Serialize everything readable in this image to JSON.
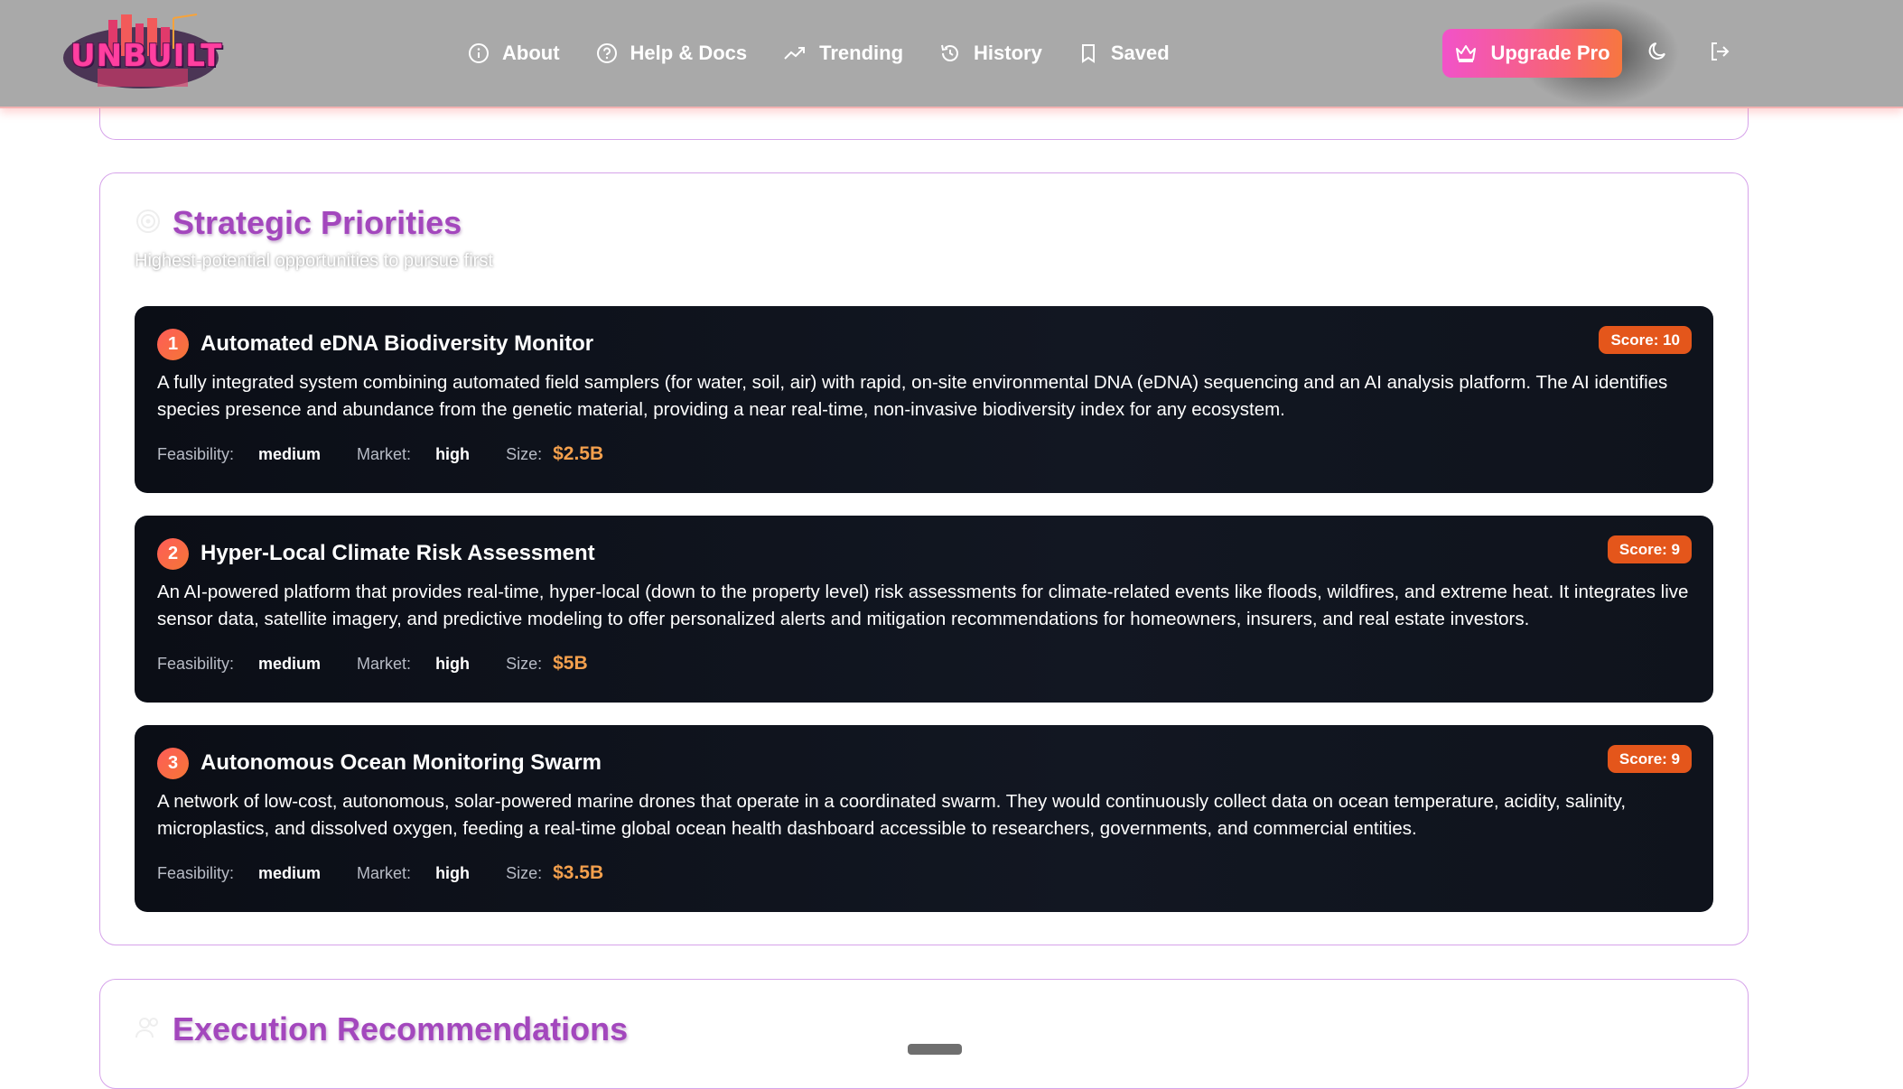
{
  "app": {
    "logo_text": "UNBUILT"
  },
  "nav": {
    "links": [
      {
        "label": "About",
        "icon": "info-circle-icon"
      },
      {
        "label": "Help & Docs",
        "icon": "help-circle-icon"
      },
      {
        "label": "Trending",
        "icon": "trending-up-icon"
      },
      {
        "label": "History",
        "icon": "history-icon"
      },
      {
        "label": "Saved",
        "icon": "bookmark-icon"
      }
    ],
    "upgrade_label": "Upgrade Pro",
    "upgrade_icon": "crown-icon",
    "theme_icon": "moon-icon",
    "logout_icon": "logout-icon"
  },
  "strategic": {
    "title": "Strategic Priorities",
    "subtitle": "Highest-potential opportunities to pursue first",
    "icon": "target-icon",
    "items": [
      {
        "rank": "1",
        "title": "Automated eDNA Biodiversity Monitor",
        "score": "Score: 10",
        "description": "A fully integrated system combining automated field samplers (for water, soil, air) with rapid, on-site environmental DNA (eDNA) sequencing and an AI analysis platform. The AI identifies species presence and abundance from the genetic material, providing a near real-time, non-invasive biodiversity index for any ecosystem.",
        "feasibility_label": "Feasibility:",
        "feasibility": "medium",
        "market_label": "Market:",
        "market": "high",
        "size_label": "Size:",
        "size": "$2.5B"
      },
      {
        "rank": "2",
        "title": "Hyper-Local Climate Risk Assessment",
        "score": "Score: 9",
        "description": "An AI-powered platform that provides real-time, hyper-local (down to the property level) risk assessments for climate-related events like floods, wildfires, and extreme heat. It integrates live sensor data, satellite imagery, and predictive modeling to offer personalized alerts and mitigation recommendations for homeowners, insurers, and real estate investors.",
        "feasibility_label": "Feasibility:",
        "feasibility": "medium",
        "market_label": "Market:",
        "market": "high",
        "size_label": "Size:",
        "size": "$5B"
      },
      {
        "rank": "3",
        "title": "Autonomous Ocean Monitoring Swarm",
        "score": "Score: 9",
        "description": "A network of low-cost, autonomous, solar-powered marine drones that operate in a coordinated swarm. They would continuously collect data on ocean temperature, acidity, salinity, microplastics, and dissolved oxygen, feeding a real-time global ocean health dashboard accessible to researchers, governments, and commercial entities.",
        "feasibility_label": "Feasibility:",
        "feasibility": "medium",
        "market_label": "Market:",
        "market": "high",
        "size_label": "Size:",
        "size": "$3.5B"
      }
    ]
  },
  "execution": {
    "title": "Execution Recommendations",
    "icon": "users-icon"
  },
  "colors": {
    "accent_purple": "#a347bd",
    "score_orange": "#e4561b",
    "size_orange": "#f4a04d",
    "card_dark": "#0b0e16"
  }
}
